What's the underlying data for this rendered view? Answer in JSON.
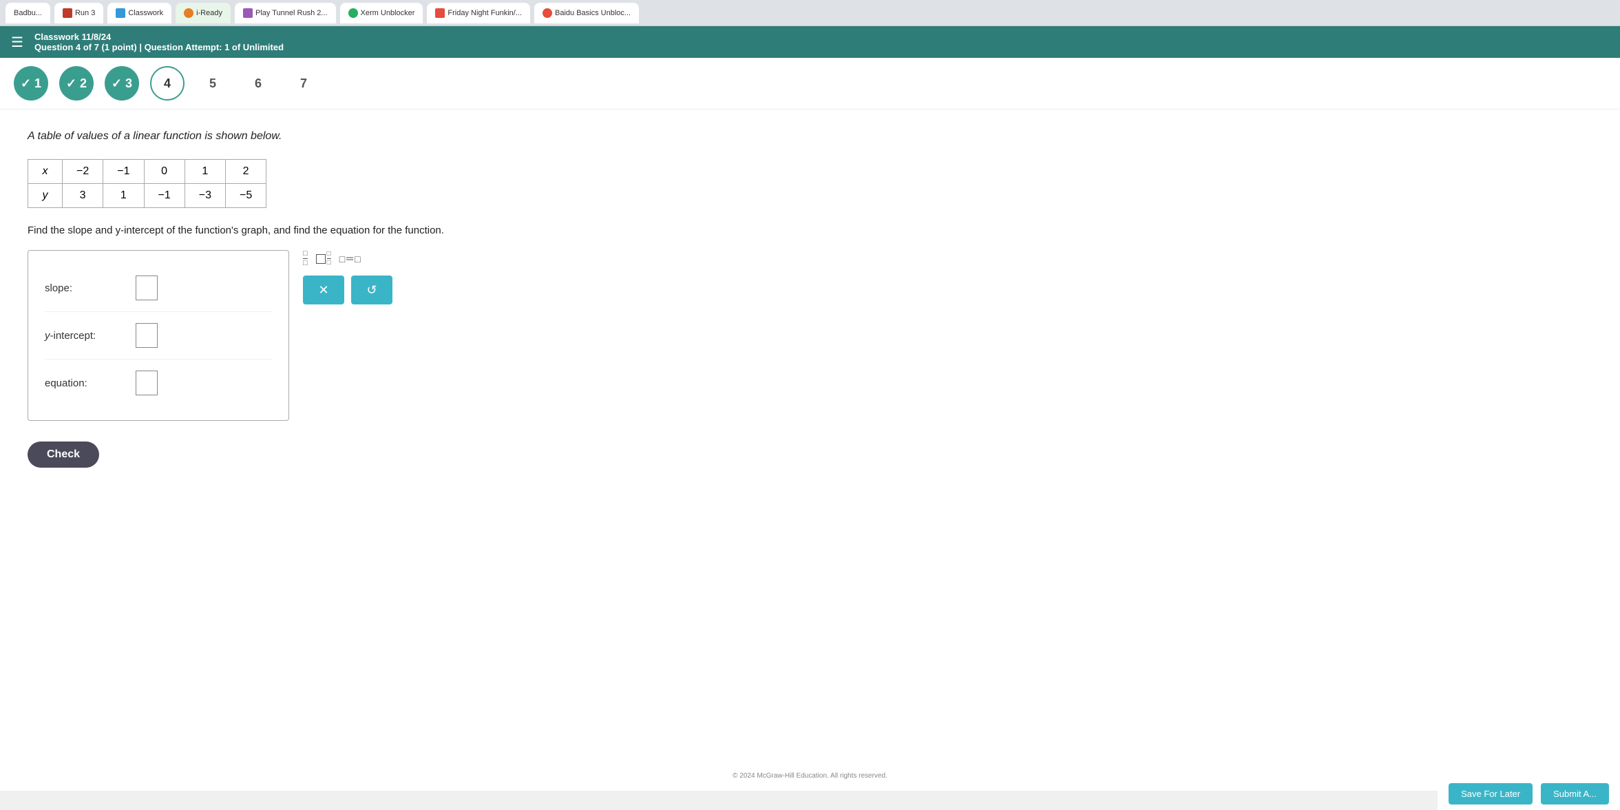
{
  "browser": {
    "tabs": [
      {
        "label": "Badbu...",
        "active": false
      },
      {
        "label": "Run 3",
        "active": false
      },
      {
        "label": "Classwork",
        "active": false
      },
      {
        "label": "i-Ready",
        "active": true
      },
      {
        "label": "Play Tunnel Rush 2...",
        "active": false
      },
      {
        "label": "Xerm Unblocker",
        "active": false
      },
      {
        "label": "Friday Night Funkin/...",
        "active": false
      },
      {
        "label": "Baidu Basics Unbloc...",
        "active": false
      }
    ]
  },
  "header": {
    "menu_icon": "☰",
    "classwork_date": "Classwork 11/8/24",
    "question_info": "Question 4 of 7 (1 point)  |  Question Attempt: 1 of Unlimited"
  },
  "question_nav": {
    "bubbles": [
      {
        "number": "1",
        "state": "completed",
        "label": "✓ 1"
      },
      {
        "number": "2",
        "state": "completed",
        "label": "✓ 2"
      },
      {
        "number": "3",
        "state": "completed",
        "label": "✓ 3"
      },
      {
        "number": "4",
        "state": "current",
        "label": "4"
      },
      {
        "number": "5",
        "state": "future",
        "label": "5"
      },
      {
        "number": "6",
        "state": "future",
        "label": "6"
      },
      {
        "number": "7",
        "state": "future",
        "label": "7"
      }
    ]
  },
  "question": {
    "text": "A table of values of a linear function is shown below.",
    "table": {
      "x_label": "x",
      "y_label": "y",
      "x_values": [
        "-2",
        "-1",
        "0",
        "1",
        "2"
      ],
      "y_values": [
        "3",
        "1",
        "-1",
        "-3",
        "-5"
      ]
    },
    "find_text": "Find the slope and y-intercept of the function's graph, and find the equation for the function.",
    "fields": [
      {
        "label": "slope:",
        "id": "slope"
      },
      {
        "label": "y-intercept:",
        "id": "y-intercept"
      },
      {
        "label": "equation:",
        "id": "equation"
      }
    ]
  },
  "buttons": {
    "check_label": "Check",
    "save_later_label": "Save For Later",
    "submit_label": "Submit A...",
    "x_label": "✕",
    "undo_label": "↺"
  },
  "copyright": "© 2024 McGraw-Hill Education. All rights reserved."
}
